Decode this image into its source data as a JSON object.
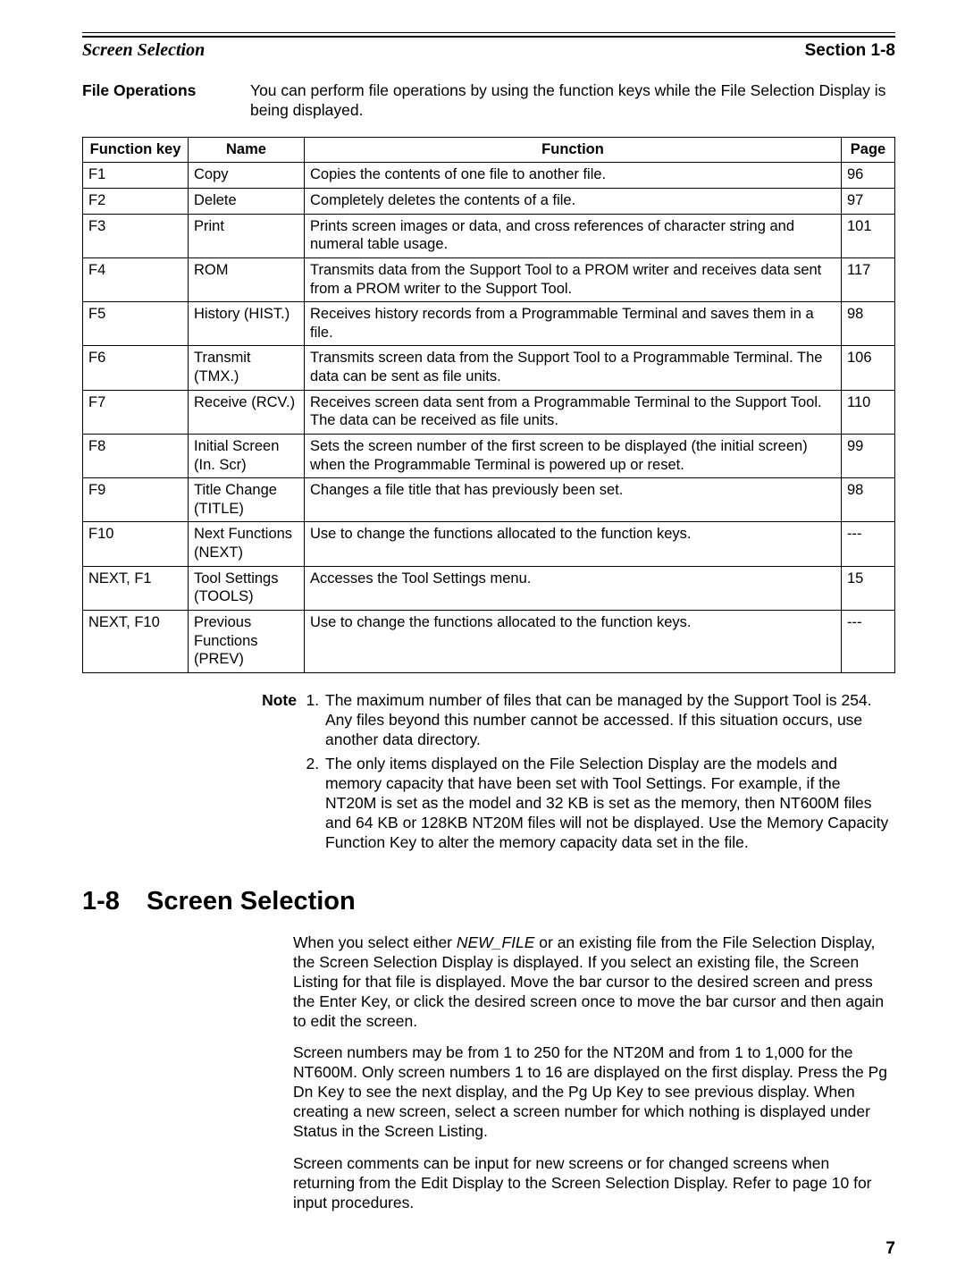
{
  "header": {
    "left": "Screen Selection",
    "right": "Section 1-8"
  },
  "file_ops": {
    "label": "File Operations",
    "text": "You can perform file operations by using the function keys while the File Selection Display is being displayed."
  },
  "columns": {
    "key": "Function key",
    "name": "Name",
    "func": "Function",
    "page": "Page"
  },
  "rows": [
    {
      "key": "F1",
      "name": "Copy",
      "func": "Copies the contents of one file to another file.",
      "page": "96"
    },
    {
      "key": "F2",
      "name": "Delete",
      "func": "Completely deletes the contents of a file.",
      "page": "97"
    },
    {
      "key": "F3",
      "name": "Print",
      "func": "Prints screen images or data, and cross references of character string and numeral table usage.",
      "page": "101"
    },
    {
      "key": "F4",
      "name": "ROM",
      "func": "Transmits data from the Support Tool to a PROM writer and receives data sent from a PROM writer to the Support Tool.",
      "page": "117"
    },
    {
      "key": "F5",
      "name": "History (HIST.)",
      "func": "Receives history records from a Programmable Terminal and saves them in a file.",
      "page": "98"
    },
    {
      "key": "F6",
      "name": "Transmit (TMX.)",
      "func": "Transmits screen data from the Support Tool to a Programmable Terminal. The data can be sent as file units.",
      "page": "106"
    },
    {
      "key": "F7",
      "name": "Receive (RCV.)",
      "func": "Receives screen data sent from a Programmable Terminal to the Support Tool. The data can be received as file units.",
      "page": "110"
    },
    {
      "key": "F8",
      "name": "Initial Screen (In. Scr)",
      "func": "Sets the screen number of the first screen to be displayed (the initial screen) when the Programmable Terminal is powered up or reset.",
      "page": "99"
    },
    {
      "key": "F9",
      "name": "Title Change (TITLE)",
      "func": "Changes a file title that has previously been set.",
      "page": "98"
    },
    {
      "key": "F10",
      "name": "Next Functions (NEXT)",
      "func": "Use to change the functions allocated to the function keys.",
      "page": "---"
    },
    {
      "key": "NEXT, F1",
      "name": "Tool Settings (TOOLS)",
      "func": "Accesses the Tool Settings menu.",
      "page": "15"
    },
    {
      "key": "NEXT, F10",
      "name": "Previous Functions (PREV)",
      "func": "Use to change the functions allocated to the function keys.",
      "page": "---"
    }
  ],
  "note": {
    "label": "Note",
    "items": [
      "The maximum number of files that can be managed by the Support Tool is 254. Any files beyond this number cannot be accessed. If this situation occurs, use another data directory.",
      "The only items displayed on the File Selection Display are the models and memory capacity that have been set with Tool Settings. For example, if the NT20M is set as the model and 32 KB is set as the memory, then NT600M files and 64 KB or 128KB NT20M files will not be displayed. Use the Memory Capacity Function Key to alter the memory capacity data set in the file."
    ]
  },
  "section": {
    "num": "1-8",
    "title": "Screen Selection",
    "p1a": "When you select either ",
    "p1file": "NEW_FILE",
    "p1b": " or an existing file from the File Selection Display, the Screen Selection Display is displayed. If you select an existing file, the Screen Listing for that file is displayed. Move the bar cursor to the desired screen and press the Enter Key, or click the desired screen once to move the bar cursor and then again to edit the screen.",
    "p2": "Screen numbers may be from 1 to 250 for the NT20M and from 1 to 1,000 for the NT600M. Only screen numbers 1 to 16 are displayed on the first display. Press the Pg Dn Key to see the next display, and the Pg Up Key to see previous display. When creating a new screen, select a screen number for which nothing is displayed under Status in the Screen Listing.",
    "p3": "Screen comments can be input for new screens or for changed screens when returning from the Edit Display to the Screen Selection Display. Refer to page 10 for input procedures."
  },
  "page_number": "7"
}
